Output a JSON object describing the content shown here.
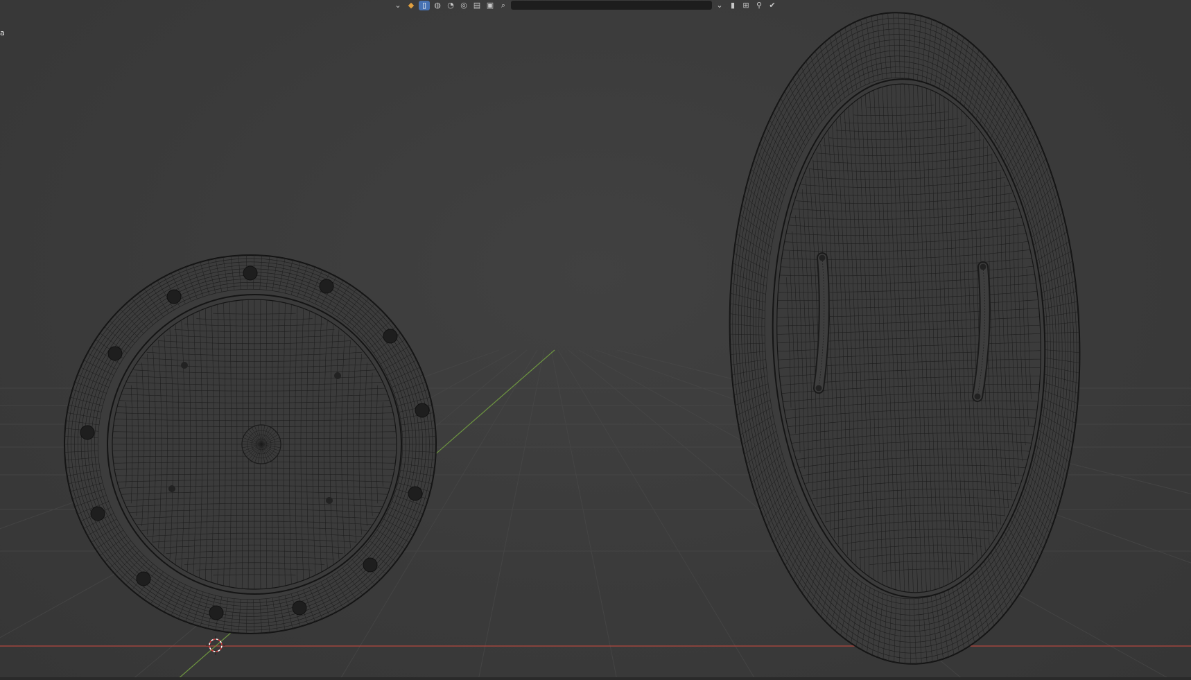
{
  "header": {
    "search_value": "",
    "search_placeholder": "",
    "buttons": [
      {
        "icon": "chevron-down-icon"
      },
      {
        "icon": "color-palette-icon"
      },
      {
        "icon": "document-icon",
        "active": true
      },
      {
        "icon": "sphere-icon"
      },
      {
        "icon": "material-icon"
      },
      {
        "icon": "world-icon"
      },
      {
        "icon": "image-icon"
      },
      {
        "icon": "properties-icon"
      },
      {
        "icon": "search-icon"
      },
      {
        "icon": "filter-icon"
      },
      {
        "icon": "bookmark-icon"
      },
      {
        "icon": "view-layout-icon"
      },
      {
        "icon": "pin-icon"
      },
      {
        "icon": "check-icon"
      }
    ]
  },
  "viewport": {
    "corner_label": "a",
    "background_color": "#3d3d3d",
    "grid_color": "#474747",
    "x_axis_color": "#b4473f",
    "y_axis_color": "#6e9640",
    "wire_color": "#1c1c1c"
  },
  "objects": [
    {
      "name": "round-shield",
      "type": "wireframe"
    },
    {
      "name": "oval-shield",
      "type": "wireframe"
    }
  ]
}
